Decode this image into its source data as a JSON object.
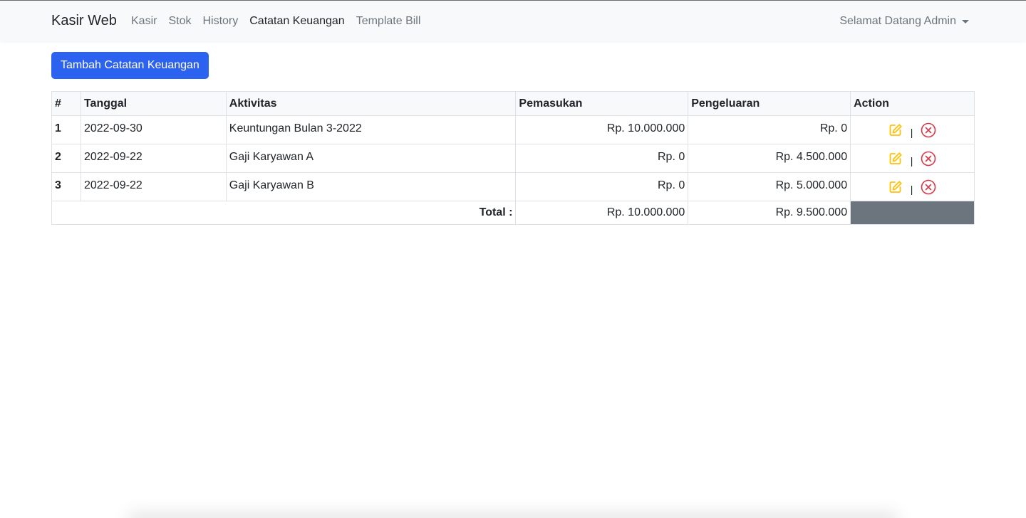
{
  "navbar": {
    "brand": "Kasir Web",
    "links": [
      {
        "label": "Kasir"
      },
      {
        "label": "Stok"
      },
      {
        "label": "History"
      },
      {
        "label": "Catatan Keuangan"
      },
      {
        "label": "Template Bill"
      }
    ],
    "active_link": "Catatan Keuangan",
    "user_menu": "Selamat Datang Admin"
  },
  "main": {
    "add_button": "Tambah Catatan Keuangan",
    "table": {
      "headers": [
        "#",
        "Tanggal",
        "Aktivitas",
        "Pemasukan",
        "Pengeluaran",
        "Action"
      ],
      "rows": [
        {
          "no": "1",
          "tanggal": "2022-09-30",
          "aktivitas": "Keuntungan Bulan 3-2022",
          "pemasukan": "Rp. 10.000.000",
          "pengeluaran": "Rp. 0"
        },
        {
          "no": "2",
          "tanggal": "2022-09-22",
          "aktivitas": "Gaji Karyawan A",
          "pemasukan": "Rp. 0",
          "pengeluaran": "Rp. 4.500.000"
        },
        {
          "no": "3",
          "tanggal": "2022-09-22",
          "aktivitas": "Gaji Karyawan B",
          "pemasukan": "Rp. 0",
          "pengeluaran": "Rp. 5.000.000"
        }
      ],
      "action_separator": "|",
      "total": {
        "label": "Total :",
        "pemasukan": "Rp. 10.000.000",
        "pengeluaran": "Rp. 9.500.000"
      }
    }
  },
  "icons": {
    "edit": "edit-icon",
    "delete": "delete-icon"
  },
  "colors": {
    "primary": "#2c62f0",
    "edit_icon": "#ffc107",
    "delete_icon": "#dc3545",
    "total_action_cell": "#6c757d",
    "navbar_bg": "#f8f9fa"
  }
}
